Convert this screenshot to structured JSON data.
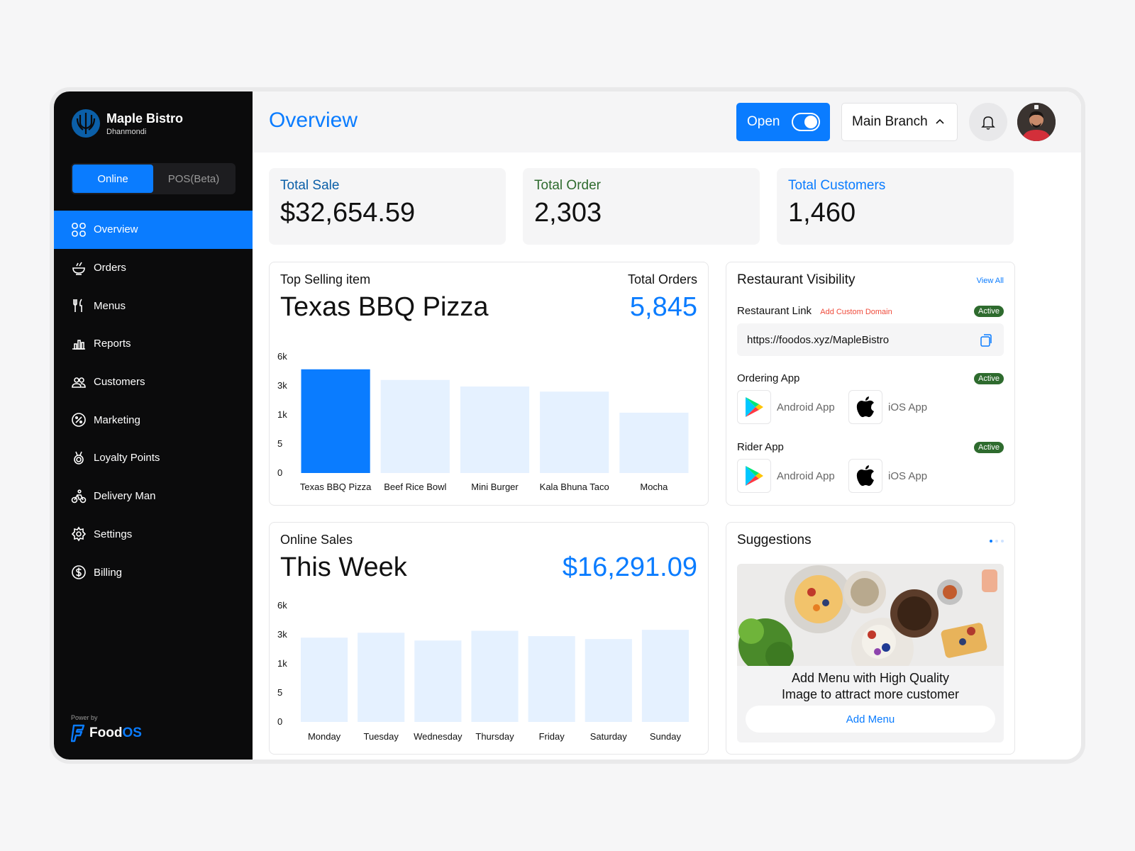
{
  "brand": {
    "name": "Maple Bistro",
    "location": "Dhanmondi"
  },
  "mode": {
    "online": "Online",
    "pos": "POS(Beta)"
  },
  "nav": [
    {
      "label": "Overview",
      "icon": "grid-icon"
    },
    {
      "label": "Orders",
      "icon": "bowl-icon"
    },
    {
      "label": "Menus",
      "icon": "utensils-icon"
    },
    {
      "label": "Reports",
      "icon": "chart-icon"
    },
    {
      "label": "Customers",
      "icon": "users-icon"
    },
    {
      "label": "Marketing",
      "icon": "percent-icon"
    },
    {
      "label": "Loyalty Points",
      "icon": "medal-icon"
    },
    {
      "label": "Delivery Man",
      "icon": "bike-icon"
    },
    {
      "label": "Settings",
      "icon": "gear-icon"
    },
    {
      "label": "Billing",
      "icon": "dollar-icon"
    }
  ],
  "powered": {
    "by": "Power by",
    "food": "Food",
    "os": "OS"
  },
  "header": {
    "title": "Overview",
    "open_label": "Open",
    "branch": "Main Branch"
  },
  "stats": [
    {
      "label": "Total Sale",
      "value": "$32,654.59",
      "color": "#0b5fa8"
    },
    {
      "label": "Total Order",
      "value": "2,303",
      "color": "#2e6b2e"
    },
    {
      "label": "Total Customers",
      "value": "1,460",
      "color": "#0a7cff"
    }
  ],
  "top_selling": {
    "label": "Top Selling item",
    "name": "Texas BBQ Pizza",
    "total_label": "Total Orders",
    "total": "5,845"
  },
  "visibility": {
    "title": "Restaurant Visibility",
    "view_all": "View All",
    "link_label": "Restaurant Link",
    "custom_domain": "Add Custom Domain",
    "link_status": "Active",
    "url": "https://foodos.xyz/MapleBistro",
    "ordering_label": "Ordering App",
    "ordering_status": "Active",
    "rider_label": "Rider App",
    "rider_status": "Active",
    "android": "Android App",
    "ios": "iOS App"
  },
  "online_sales": {
    "label": "Online Sales",
    "period": "This Week",
    "total": "$16,291.09"
  },
  "suggestions": {
    "title": "Suggestions",
    "line1": "Add Menu with High Quality",
    "line2": "Image to attract more customer",
    "button": "Add Menu"
  },
  "chart_data": [
    {
      "type": "bar",
      "categories": [
        "Texas BBQ Pizza",
        "Beef Rice Bowl",
        "Mini Burger",
        "Kala Bhuna Taco",
        "Mocha"
      ],
      "values": [
        4700,
        3600,
        2950,
        2600,
        1150
      ],
      "yticks": [
        "6k",
        "3k",
        "1k",
        "5",
        "0"
      ],
      "highlight_index": 0,
      "colors": {
        "highlight": "#0a7cff",
        "normal": "#e5f1ff"
      }
    },
    {
      "type": "bar",
      "categories": [
        "Monday",
        "Tuesday",
        "Wednesday",
        "Thursday",
        "Friday",
        "Saturday",
        "Sunday"
      ],
      "values": [
        2800,
        3200,
        2600,
        3400,
        2900,
        2700,
        3500
      ],
      "yticks": [
        "6k",
        "3k",
        "1k",
        "5",
        "0"
      ],
      "colors": {
        "normal": "#e5f1ff"
      }
    }
  ]
}
